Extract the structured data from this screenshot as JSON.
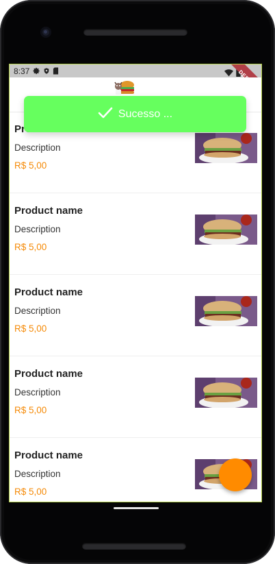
{
  "status_bar": {
    "time": "8:37",
    "left_icons": [
      "settings-icon",
      "shield-icon",
      "sim-card-icon"
    ],
    "right_icons": [
      "wifi-icon",
      "battery-icon"
    ]
  },
  "debug_banner": {
    "label": "DEBUG",
    "color": "#b13f47"
  },
  "app_bar": {
    "logo_icon": "burger-mascot-logo"
  },
  "toast": {
    "icon": "check-icon",
    "message": "Sucesso ...",
    "color": "#66ff5e"
  },
  "products": [
    {
      "name": "Product name",
      "description": "Description",
      "price": "R$ 5,00",
      "image_icon": "sandwich-image"
    },
    {
      "name": "Product name",
      "description": "Description",
      "price": "R$ 5,00",
      "image_icon": "sandwich-image"
    },
    {
      "name": "Product name",
      "description": "Description",
      "price": "R$ 5,00",
      "image_icon": "sandwich-image"
    },
    {
      "name": "Product name",
      "description": "Description",
      "price": "R$ 5,00",
      "image_icon": "sandwich-image"
    },
    {
      "name": "Product name",
      "description": "Description",
      "price": "R$ 5,00",
      "image_icon": "sandwich-image"
    }
  ],
  "colors": {
    "price": "#f58a07",
    "fab": "#ff8b00",
    "accent_outline": "#b6d34a"
  },
  "fab": {
    "icon": "fab-button"
  }
}
